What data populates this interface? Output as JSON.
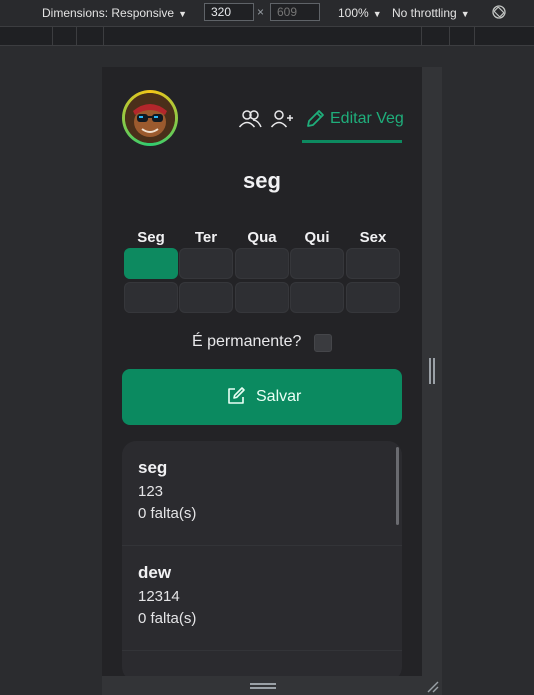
{
  "devtools": {
    "dimensions_label": "Dimensions: Responsive",
    "width_value": "320",
    "height_placeholder": "609",
    "times_sign": "×",
    "zoom": "100%",
    "throttling": "No throttling"
  },
  "app": {
    "nav": {
      "edit_label": "Editar Veg"
    },
    "title": "seg",
    "days": [
      "Seg",
      "Ter",
      "Qua",
      "Qui",
      "Sex"
    ],
    "permanent_label": "É permanente?",
    "permanent_checked": false,
    "save_label": "Salvar",
    "items": [
      {
        "name": "seg",
        "code": "123",
        "absences": "0 falta(s)"
      },
      {
        "name": "dew",
        "code": "12314",
        "absences": "0 falta(s)"
      }
    ]
  },
  "colors": {
    "accent": "#0b8a60",
    "accent_text": "#1fae7b",
    "background": "#232326"
  }
}
